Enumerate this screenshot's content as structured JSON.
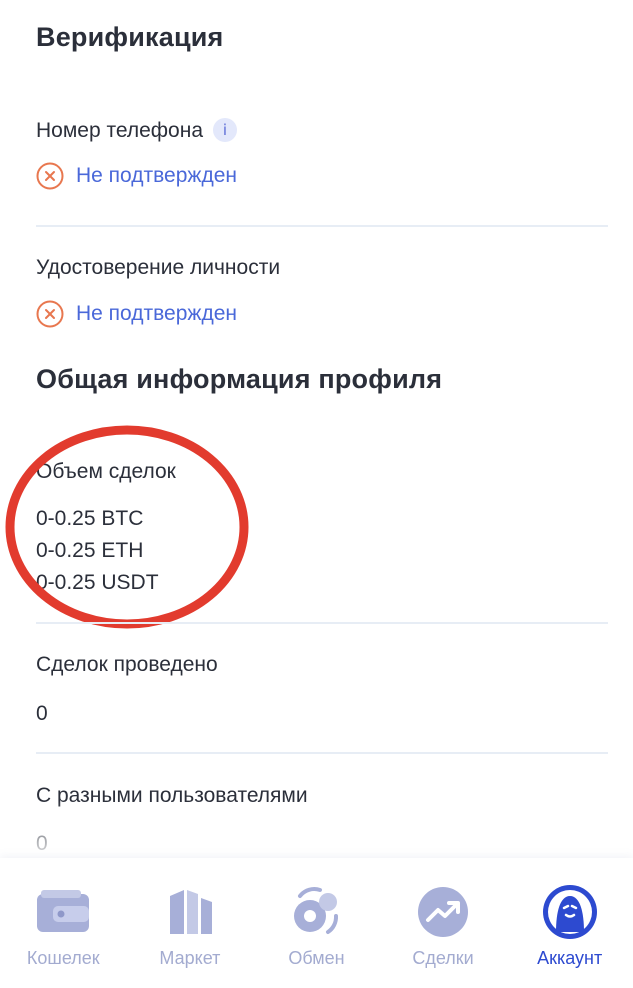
{
  "verification": {
    "title": "Верификация",
    "phone": {
      "label": "Номер телефона",
      "info_icon": "i",
      "status": "Не подтвержден"
    },
    "identity": {
      "label": "Удостоверение личности",
      "status": "Не подтвержден"
    }
  },
  "profile": {
    "title": "Общая информация профиля",
    "volume": {
      "label": "Объем сделок",
      "values": [
        "0-0.25 BTC",
        "0-0.25 ETH",
        "0-0.25 USDT"
      ]
    },
    "deals": {
      "label": "Сделок проведено",
      "value": "0"
    },
    "users": {
      "label": "С разными пользователями",
      "value": "0"
    }
  },
  "tabbar": {
    "active": "account",
    "items": [
      {
        "id": "wallet",
        "label": "Кошелек",
        "icon": "wallet-icon"
      },
      {
        "id": "market",
        "label": "Маркет",
        "icon": "market-icon"
      },
      {
        "id": "exchange",
        "label": "Обмен",
        "icon": "exchange-icon"
      },
      {
        "id": "deals",
        "label": "Сделки",
        "icon": "trend-icon"
      },
      {
        "id": "account",
        "label": "Аккаунт",
        "icon": "avatar-icon"
      }
    ]
  },
  "colors": {
    "link": "#4a68d9",
    "status_icon": "#e8774f",
    "annotation_circle": "#e23b2e",
    "tab_inactive": "#a3abd0",
    "tab_active": "#2d4ad0"
  }
}
